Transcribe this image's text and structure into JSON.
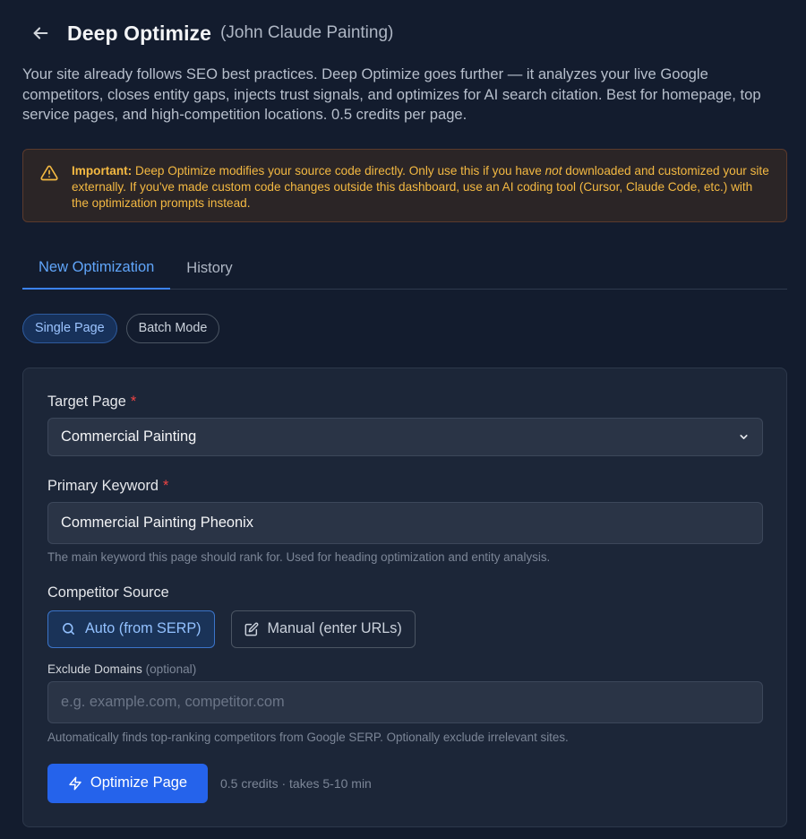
{
  "header": {
    "title": "Deep Optimize",
    "subtitle": "(John Claude Painting)"
  },
  "intro": "Your site already follows SEO best practices. Deep Optimize goes further — it analyzes your live Google competitors, closes entity gaps, injects trust signals, and optimizes for AI search citation. Best for homepage, top service pages, and high-competition locations. 0.5 credits per page.",
  "warning": {
    "strong": "Important:",
    "text_before": " Deep Optimize modifies your source code directly. Only use this if you have ",
    "emphasis": "not",
    "text_after": " downloaded and customized your site externally. If you've made custom code changes outside this dashboard, use an AI coding tool (Cursor, Claude Code, etc.) with the optimization prompts instead.",
    "color": "#f4b942"
  },
  "tabs": [
    {
      "label": "New Optimization",
      "active": true
    },
    {
      "label": "History",
      "active": false
    }
  ],
  "modes": [
    {
      "label": "Single Page",
      "active": true
    },
    {
      "label": "Batch Mode",
      "active": false
    }
  ],
  "form": {
    "target_page": {
      "label": "Target Page",
      "value": "Commercial Painting"
    },
    "primary_keyword": {
      "label": "Primary Keyword",
      "value": "Commercial Painting Pheonix",
      "help": "The main keyword this page should rank for. Used for heading optimization and entity analysis."
    },
    "competitor_source": {
      "label": "Competitor Source",
      "auto_label": "Auto (from SERP)",
      "manual_label": "Manual (enter URLs)",
      "selected": "auto"
    },
    "exclude_domains": {
      "label": "Exclude Domains",
      "optional": "(optional)",
      "placeholder": "e.g. example.com, competitor.com",
      "help": "Automatically finds top-ranking competitors from Google SERP. Optionally exclude irrelevant sites."
    },
    "submit_label": "Optimize Page",
    "credits_note": "0.5 credits · takes 5-10 min"
  },
  "colors": {
    "accent": "#2563eb",
    "required": "#ef4444",
    "background": "#131c2e"
  }
}
